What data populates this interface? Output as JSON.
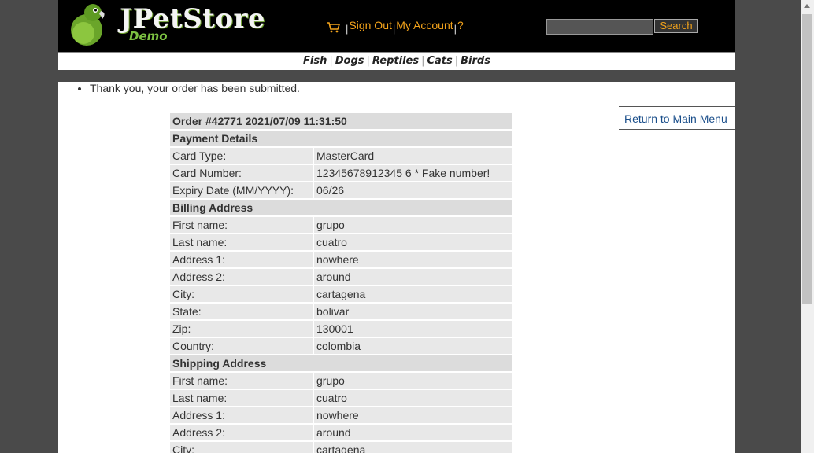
{
  "header": {
    "logo_title": "JPetStore",
    "logo_subtitle": "Demo",
    "cart_icon": "shopping-cart-icon",
    "sign_out": "Sign Out",
    "my_account": "My Account",
    "help": "?",
    "separator": "|",
    "search_value": "",
    "search_button": "Search",
    "accent_color": "#f3a31b"
  },
  "quicklinks": {
    "items": [
      "Fish",
      "Dogs",
      "Reptiles",
      "Cats",
      "Birds"
    ],
    "separator": "|"
  },
  "messages": [
    "Thank you, your order has been submitted."
  ],
  "return_link": "Return to Main Menu",
  "order": {
    "title": "Order #42771 2021/07/09 11:31:50",
    "payment_header": "Payment Details",
    "payment": [
      {
        "label": "Card Type:",
        "value": "MasterCard"
      },
      {
        "label": "Card Number:",
        "value": "12345678912345 6 * Fake number!"
      },
      {
        "label": "Expiry Date (MM/YYYY):",
        "value": "06/26"
      }
    ],
    "billing_header": "Billing Address",
    "billing": [
      {
        "label": "First name:",
        "value": "grupo"
      },
      {
        "label": "Last name:",
        "value": "cuatro"
      },
      {
        "label": "Address 1:",
        "value": "nowhere"
      },
      {
        "label": "Address 2:",
        "value": "around"
      },
      {
        "label": "City:",
        "value": "cartagena"
      },
      {
        "label": "State:",
        "value": "bolivar"
      },
      {
        "label": "Zip:",
        "value": "130001"
      },
      {
        "label": "Country:",
        "value": "colombia"
      }
    ],
    "shipping_header": "Shipping Address",
    "shipping": [
      {
        "label": "First name:",
        "value": "grupo"
      },
      {
        "label": "Last name:",
        "value": "cuatro"
      },
      {
        "label": "Address 1:",
        "value": "nowhere"
      },
      {
        "label": "Address 2:",
        "value": "around"
      },
      {
        "label": "City:",
        "value": "cartagena"
      }
    ]
  }
}
